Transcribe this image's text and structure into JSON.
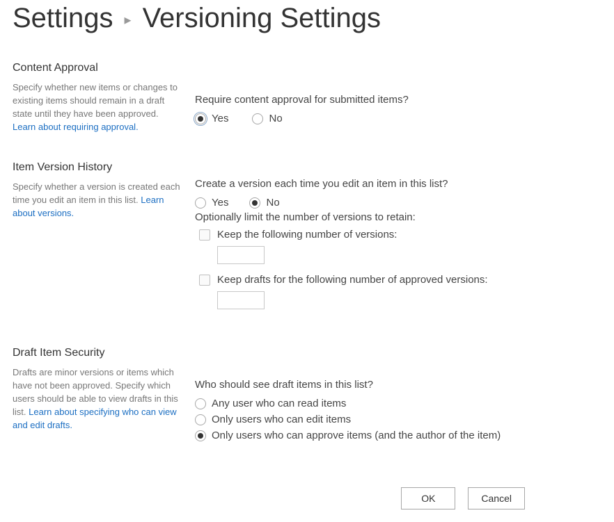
{
  "breadcrumb": {
    "parent": "Settings",
    "separator": "▸",
    "current": "Versioning Settings"
  },
  "content_approval": {
    "heading": "Content Approval",
    "desc_pre": "Specify whether new items or changes to existing items should remain in a draft state until they have been approved.  ",
    "link": "Learn about requiring approval.",
    "question": "Require content approval for submitted items?",
    "yes": "Yes",
    "no": "No",
    "selected": "yes"
  },
  "version_history": {
    "heading": "Item Version History",
    "desc_pre": "Specify whether a version is created each time you edit an item in this list.  ",
    "link": "Learn about versions.",
    "question": "Create a version each time you edit an item in this list?",
    "yes": "Yes",
    "no": "No",
    "selected": "no",
    "sub_question": "Optionally limit the number of versions to retain:",
    "keep_versions_label": "Keep the following number of versions:",
    "keep_versions_value": "",
    "keep_drafts_label": "Keep drafts for the following number of approved versions:",
    "keep_drafts_value": ""
  },
  "draft_security": {
    "heading": "Draft Item Security",
    "desc_pre": "Drafts are minor versions or items which have not been approved. Specify which users should be able to view drafts in this list.  ",
    "link": "Learn about specifying who can view and edit drafts.",
    "question": "Who should see draft items in this list?",
    "options": [
      "Any user who can read items",
      "Only users who can edit items",
      "Only users who can approve items (and the author of the item)"
    ],
    "selected_index": 2
  },
  "buttons": {
    "ok": "OK",
    "cancel": "Cancel"
  }
}
